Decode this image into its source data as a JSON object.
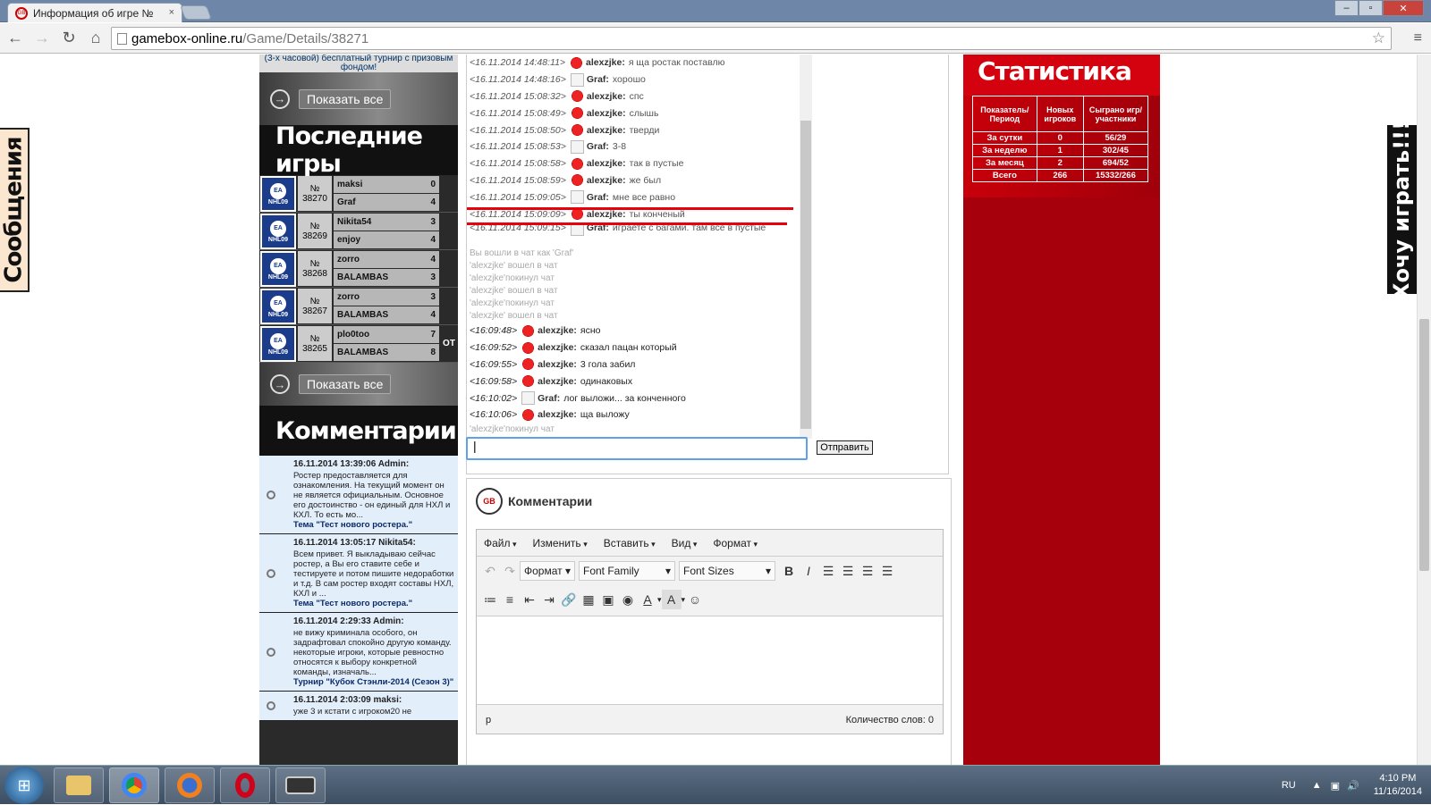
{
  "browser": {
    "tab_title": "Информация об игре №",
    "tab_close": "×",
    "url_host": "gamebox-online.ru",
    "url_path": "/Game/Details/38271",
    "star": "☆",
    "menu": "≡",
    "win_min": "–",
    "win_max": "▫",
    "win_close": "✕"
  },
  "side_tabs": {
    "messages": "Сообщения",
    "want_play": "Хочу играть!!!"
  },
  "left": {
    "promo_text": "(3-х часовой) бесплатный турнир с призовым фондом!",
    "show_all_label": "Показать все",
    "recent_games_title": "Последние игры",
    "games": [
      {
        "num_prefix": "№",
        "num": "38270",
        "p1": "maksi",
        "s1": "0",
        "p2": "Graf",
        "s2": "4",
        "ot": ""
      },
      {
        "num_prefix": "№",
        "num": "38269",
        "p1": "Nikita54",
        "s1": "3",
        "p2": "enjoy",
        "s2": "4",
        "ot": ""
      },
      {
        "num_prefix": "№",
        "num": "38268",
        "p1": "zorro",
        "s1": "4",
        "p2": "BALAMBAS",
        "s2": "3",
        "ot": ""
      },
      {
        "num_prefix": "№",
        "num": "38267",
        "p1": "zorro",
        "s1": "3",
        "p2": "BALAMBAS",
        "s2": "4",
        "ot": ""
      },
      {
        "num_prefix": "№",
        "num": "38265",
        "p1": "plo0too",
        "s1": "7",
        "p2": "BALAMBAS",
        "s2": "8",
        "ot": "OT"
      }
    ],
    "comments_title": "Комментарии",
    "comments": [
      {
        "head": "16.11.2014 13:39:06   Admin:",
        "text": "Ростер предоставляется для ознакомления. На текущий момент он не является официальным. Основное его достоинство - он единый для НХЛ и КХЛ. То есть мо...",
        "topic": "Тема \"Тест нового ростера.\""
      },
      {
        "head": "16.11.2014 13:05:17   Nikita54:",
        "text": "Всем привет. Я выкладываю сейчас ростер, а Вы его ставите себе и тестируете и потом пишите недоработки и т.д. В сам ростер входят составы НХЛ, КХЛ и ...",
        "topic": "Тема \"Тест нового ростера.\""
      },
      {
        "head": "16.11.2014 2:29:33   Admin:",
        "text": "не вижу криминала особого, он задрафтовал спокойно другую команду. некоторые игроки, которые ревностно относятся к выбору конкретной команды, изначаль...",
        "topic": "Турнир \"Кубок Стэнли-2014 (Сезон 3)\""
      },
      {
        "head": "16.11.2014 2:03:09   maksi:",
        "text": "уже 3 и кстати с игроком20 не",
        "topic": ""
      }
    ]
  },
  "chat": {
    "lines": [
      {
        "kind": "msg",
        "time": "<16.11.2014 14:48:11>",
        "avatar": "red",
        "user": "alexzjke:",
        "text": "я ща ростак поставлю"
      },
      {
        "kind": "msg",
        "time": "<16.11.2014 14:48:16>",
        "avatar": "grey",
        "user": "Graf:",
        "text": "хорошо"
      },
      {
        "kind": "msg",
        "time": "<16.11.2014 15:08:32>",
        "avatar": "red",
        "user": "alexzjke:",
        "text": "спс"
      },
      {
        "kind": "msg",
        "time": "<16.11.2014 15:08:49>",
        "avatar": "red",
        "user": "alexzjke:",
        "text": "слышь"
      },
      {
        "kind": "msg",
        "time": "<16.11.2014 15:08:50>",
        "avatar": "red",
        "user": "alexzjke:",
        "text": "тверди"
      },
      {
        "kind": "msg",
        "time": "<16.11.2014 15:08:53>",
        "avatar": "grey",
        "user": "Graf:",
        "text": "3-8"
      },
      {
        "kind": "msg",
        "time": "<16.11.2014 15:08:58>",
        "avatar": "red",
        "user": "alexzjke:",
        "text": "так в пустые"
      },
      {
        "kind": "msg",
        "time": "<16.11.2014 15:08:59>",
        "avatar": "red",
        "user": "alexzjke:",
        "text": "же был"
      },
      {
        "kind": "msg",
        "time": "<16.11.2014 15:09:05>",
        "avatar": "grey",
        "user": "Graf:",
        "text": "мне все равно"
      },
      {
        "kind": "msg",
        "time": "<16.11.2014 15:09:09>",
        "avatar": "red",
        "user": "alexzjke:",
        "text": "ты конченый"
      },
      {
        "kind": "wrap",
        "time": "<16.11.2014 15:09:15>",
        "avatar": "grey",
        "user": "Graf:",
        "text": "играете с багами. там все в пустые"
      },
      {
        "kind": "sys",
        "text": "Вы вошли в чат как 'Graf'"
      },
      {
        "kind": "sys",
        "text": "'alexzjke' вошел в чат"
      },
      {
        "kind": "sys",
        "text": "'alexzjke'покинул чат"
      },
      {
        "kind": "sys",
        "text": "'alexzjke' вошел в чат"
      },
      {
        "kind": "sys",
        "text": "'alexzjke'покинул чат"
      },
      {
        "kind": "sys",
        "text": "'alexzjke' вошел в чат"
      },
      {
        "kind": "new",
        "time": "<16:09:48>",
        "avatar": "red",
        "user": "alexzjke:",
        "text": "ясно"
      },
      {
        "kind": "new",
        "time": "<16:09:52>",
        "avatar": "red",
        "user": "alexzjke:",
        "text": "сказал пацан который"
      },
      {
        "kind": "new",
        "time": "<16:09:55>",
        "avatar": "red",
        "user": "alexzjke:",
        "text": "3 гола забил"
      },
      {
        "kind": "new",
        "time": "<16:09:58>",
        "avatar": "red",
        "user": "alexzjke:",
        "text": "одинаковых"
      },
      {
        "kind": "new",
        "time": "<16:10:02>",
        "avatar": "grey",
        "user": "Graf:",
        "text": "лог выложи... за конченного"
      },
      {
        "kind": "new",
        "time": "<16:10:06>",
        "avatar": "red",
        "user": "alexzjke:",
        "text": "ща выложу"
      },
      {
        "kind": "sys",
        "text": "'alexzjke'покинул чат"
      }
    ],
    "input_value": "|",
    "send_label": "Отправить"
  },
  "comments_editor": {
    "title": "Комментарии",
    "logo_text": "GB",
    "menu": [
      "Файл",
      "Изменить",
      "Вставить",
      "Вид",
      "Формат"
    ],
    "format_dd": "Формат",
    "font_family_dd": "Font Family",
    "font_sizes_dd": "Font Sizes",
    "path": "p",
    "word_count": "Количество слов: 0"
  },
  "stats": {
    "title": "Статистика",
    "headers": [
      "Показатель/ Период",
      "Новых игроков",
      "Сыграно игр/ участники"
    ],
    "rows": [
      [
        "За сутки",
        "0",
        "56/29"
      ],
      [
        "За неделю",
        "1",
        "302/45"
      ],
      [
        "За месяц",
        "2",
        "694/52"
      ],
      [
        "Всего",
        "266",
        "15332/266"
      ]
    ]
  },
  "taskbar": {
    "lang": "RU",
    "time": "4:10 PM",
    "date": "11/16/2014"
  }
}
